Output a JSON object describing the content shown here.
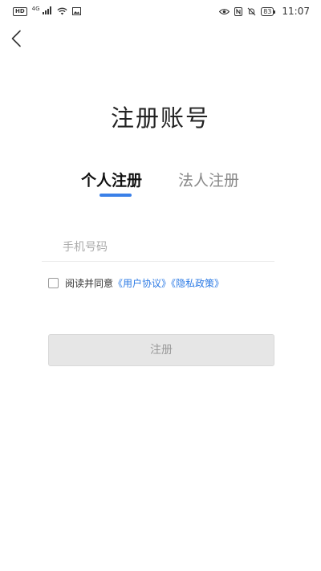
{
  "status_bar": {
    "hd_badge": "HD",
    "network_label": "4G",
    "battery_level": "83",
    "time": "11:07",
    "icons": [
      "hd-icon",
      "signal-icon",
      "wifi-icon",
      "image-icon",
      "eye-icon",
      "nfc-icon",
      "mute-icon",
      "battery-icon"
    ]
  },
  "header": {
    "back_icon": "chevron-left-icon",
    "title": "注册账号"
  },
  "tabs": [
    {
      "label": "个人注册",
      "active": true
    },
    {
      "label": "法人注册",
      "active": false
    }
  ],
  "form": {
    "phone_placeholder": "手机号码",
    "phone_value": "",
    "agreement_checked": false,
    "agreement_prefix": "阅读并同意",
    "user_agreement_link": "《用户协议》",
    "privacy_policy_link": "《隐私政策》",
    "submit_label": "注册"
  },
  "colors": {
    "accent": "#3a80e8",
    "link": "#2d7be5",
    "button_disabled_bg": "#e6e6e6",
    "button_disabled_text": "#999999"
  }
}
